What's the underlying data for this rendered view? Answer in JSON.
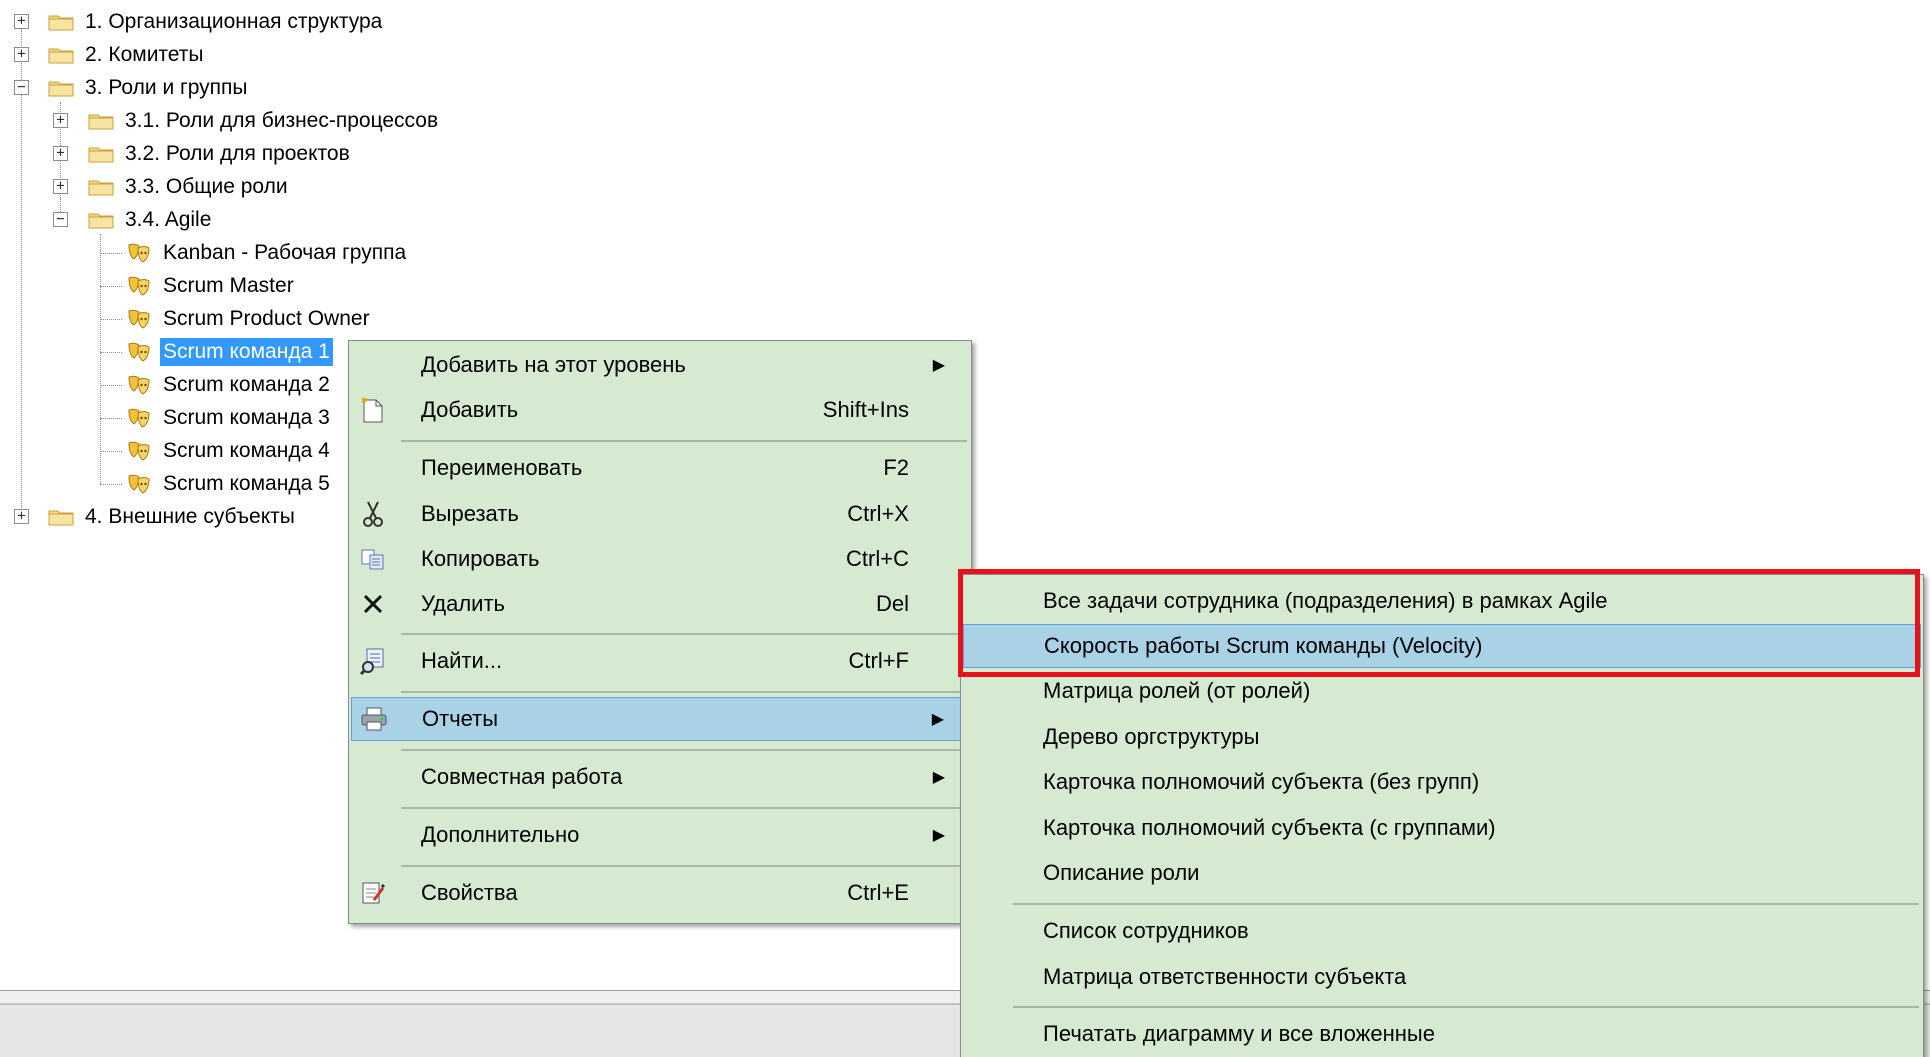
{
  "tree": {
    "nodes": [
      {
        "label": "1. Организационная структура",
        "toggle": "+"
      },
      {
        "label": "2. Комитеты",
        "toggle": "+"
      },
      {
        "label": "3. Роли и группы",
        "toggle": "−"
      },
      {
        "label": "3.1. Роли для бизнес-процессов",
        "toggle": "+"
      },
      {
        "label": "3.2. Роли для проектов",
        "toggle": "+"
      },
      {
        "label": "3.3. Общие роли",
        "toggle": "+"
      },
      {
        "label": "3.4. Agile",
        "toggle": "−"
      },
      {
        "label": "Kanban - Рабочая группа"
      },
      {
        "label": "Scrum Master"
      },
      {
        "label": "Scrum Product Owner"
      },
      {
        "label": "Scrum команда 1"
      },
      {
        "label": "Scrum команда 2"
      },
      {
        "label": "Scrum команда 3"
      },
      {
        "label": "Scrum команда 4"
      },
      {
        "label": "Scrum команда 5"
      },
      {
        "label": "4. Внешние субъекты",
        "toggle": "+"
      }
    ]
  },
  "context_menu": {
    "items": [
      {
        "label": "Добавить на этот уровень",
        "shortcut": ""
      },
      {
        "label": "Добавить",
        "shortcut": "Shift+Ins"
      },
      {
        "label": "Переименовать",
        "shortcut": "F2"
      },
      {
        "label": "Вырезать",
        "shortcut": "Ctrl+X"
      },
      {
        "label": "Копировать",
        "shortcut": "Ctrl+C"
      },
      {
        "label": "Удалить",
        "shortcut": "Del"
      },
      {
        "label": "Найти...",
        "shortcut": "Ctrl+F"
      },
      {
        "label": "Отчеты",
        "shortcut": ""
      },
      {
        "label": "Совместная работа",
        "shortcut": ""
      },
      {
        "label": "Дополнительно",
        "shortcut": ""
      },
      {
        "label": "Свойства",
        "shortcut": "Ctrl+E"
      }
    ]
  },
  "reports_submenu": {
    "items": [
      {
        "label": "Все задачи сотрудника (подразделения) в рамках Agile"
      },
      {
        "label": "Скорость работы Scrum команды (Velocity)"
      },
      {
        "label": "Матрица ролей (от ролей)"
      },
      {
        "label": "Дерево оргструктуры"
      },
      {
        "label": "Карточка полномочий субъекта (без групп)"
      },
      {
        "label": "Карточка полномочий субъекта (с группами)"
      },
      {
        "label": "Описание роли"
      },
      {
        "label": "Список сотрудников"
      },
      {
        "label": "Матрица ответственности субъекта"
      },
      {
        "label": "Печатать диаграмму и все вложенные"
      }
    ]
  },
  "colors": {
    "menu_bg": "#d6ead2",
    "menu_highlight": "#a9d2e6",
    "tree_selection": "#3399ff",
    "annotation_box": "#e8101a"
  }
}
